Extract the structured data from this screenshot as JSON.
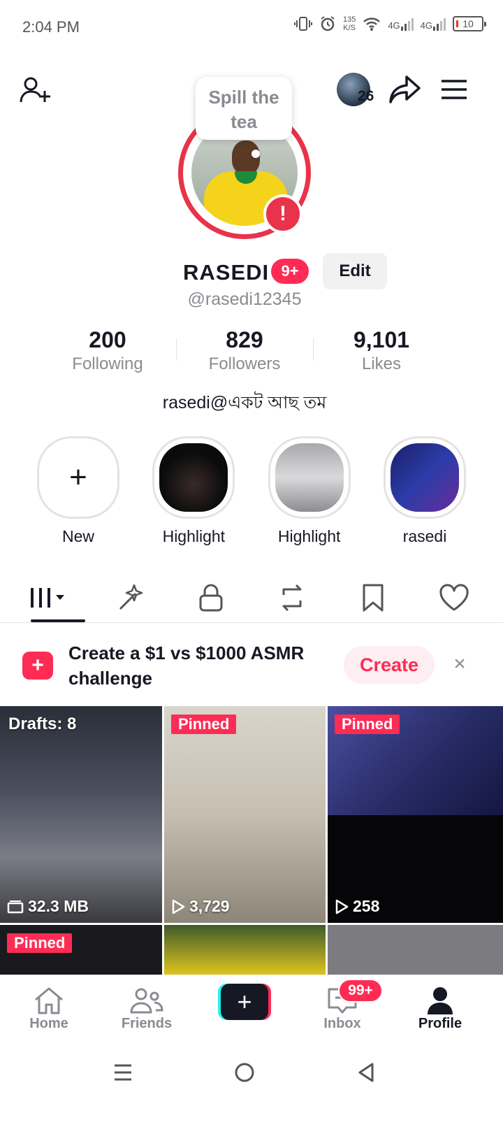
{
  "status_bar": {
    "time": "2:04 PM",
    "net_speed_value": "135",
    "net_speed_unit": "K/S",
    "signal1_label": "4G",
    "signal2_label": "4G",
    "battery": "10"
  },
  "header": {
    "viewer_count": "26",
    "story_bubble": "Spill the tea"
  },
  "profile": {
    "name": "RASEDI",
    "name_badge": "9+",
    "edit_label": "Edit",
    "handle": "@rasedi12345",
    "bio": "rasedi@একট আছ তম",
    "stats": [
      {
        "value": "200",
        "label": "Following"
      },
      {
        "value": "829",
        "label": "Followers"
      },
      {
        "value": "9,101",
        "label": "Likes"
      }
    ],
    "alert_badge": "!"
  },
  "highlights": [
    {
      "label": "New"
    },
    {
      "label": "Highlight"
    },
    {
      "label": "Highlight"
    },
    {
      "label": "rasedi"
    }
  ],
  "tabs": [
    {
      "icon": "grid-icon",
      "active": true
    },
    {
      "icon": "sparkle-icon",
      "active": false
    },
    {
      "icon": "lock-icon",
      "active": false
    },
    {
      "icon": "repost-icon",
      "active": false
    },
    {
      "icon": "bookmark-icon",
      "active": false
    },
    {
      "icon": "heart-icon",
      "active": false
    }
  ],
  "promo": {
    "text": "Create a $1 vs $1000 ASMR challenge",
    "create_label": "Create",
    "close": "×"
  },
  "videos": [
    {
      "overlay": "Drafts: 8",
      "meta": "32.3 MB"
    },
    {
      "overlay": "Pinned",
      "meta": "3,729"
    },
    {
      "overlay": "Pinned",
      "meta": "258"
    },
    {
      "overlay": "Pinned",
      "meta": ""
    }
  ],
  "bottom_nav": {
    "home": "Home",
    "friends": "Friends",
    "inbox": "Inbox",
    "inbox_badge": "99+",
    "profile": "Profile",
    "add": "+"
  },
  "colors": {
    "accent": "#fe2c55",
    "ring": "#e8334a",
    "text": "#161823",
    "muted": "#8a8b91"
  }
}
